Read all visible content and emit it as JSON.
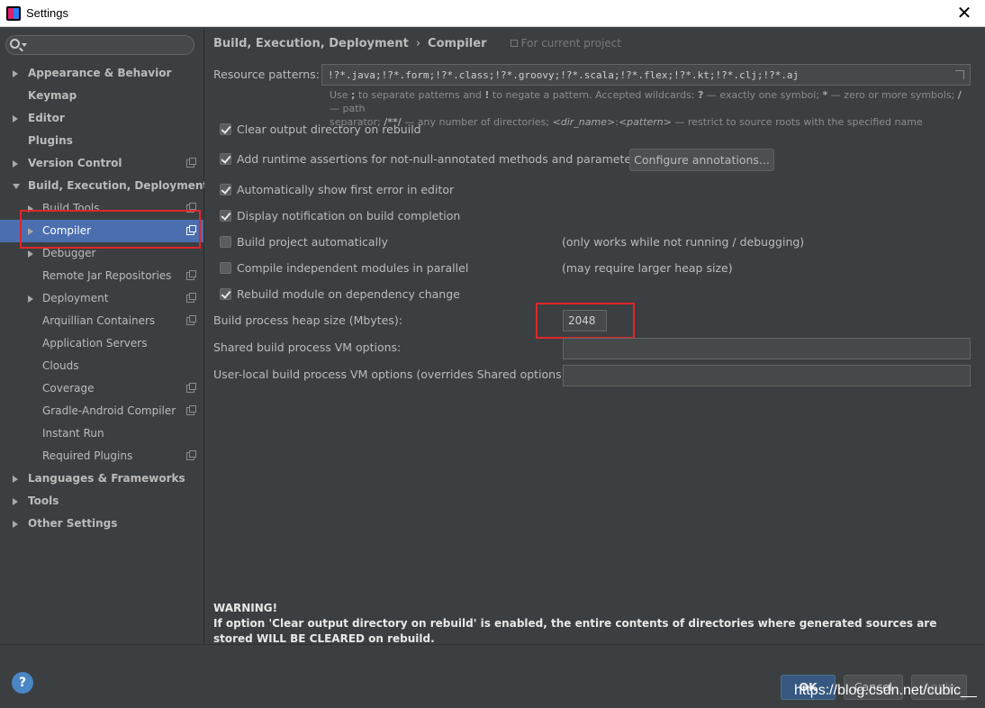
{
  "window": {
    "title": "Settings",
    "close_glyph": "✕"
  },
  "sidebar": {
    "search_placeholder": "",
    "items": [
      {
        "label": "Appearance & Behavior",
        "level": 0,
        "arrow": "right",
        "project": false
      },
      {
        "label": "Keymap",
        "level": 0,
        "arrow": "none",
        "project": false
      },
      {
        "label": "Editor",
        "level": 0,
        "arrow": "right",
        "project": false
      },
      {
        "label": "Plugins",
        "level": 0,
        "arrow": "none",
        "project": false
      },
      {
        "label": "Version Control",
        "level": 0,
        "arrow": "right",
        "project": true
      },
      {
        "label": "Build, Execution, Deployment",
        "level": 0,
        "arrow": "down",
        "project": false
      },
      {
        "label": "Build Tools",
        "level": 1,
        "arrow": "right",
        "project": true
      },
      {
        "label": "Compiler",
        "level": 1,
        "arrow": "right",
        "project": true,
        "selected": true
      },
      {
        "label": "Debugger",
        "level": 1,
        "arrow": "right",
        "project": false
      },
      {
        "label": "Remote Jar Repositories",
        "level": 1,
        "arrow": "none",
        "project": true
      },
      {
        "label": "Deployment",
        "level": 1,
        "arrow": "right",
        "project": true
      },
      {
        "label": "Arquillian Containers",
        "level": 1,
        "arrow": "none",
        "project": true
      },
      {
        "label": "Application Servers",
        "level": 1,
        "arrow": "none",
        "project": false
      },
      {
        "label": "Clouds",
        "level": 1,
        "arrow": "none",
        "project": false
      },
      {
        "label": "Coverage",
        "level": 1,
        "arrow": "none",
        "project": true
      },
      {
        "label": "Gradle-Android Compiler",
        "level": 1,
        "arrow": "none",
        "project": true
      },
      {
        "label": "Instant Run",
        "level": 1,
        "arrow": "none",
        "project": false
      },
      {
        "label": "Required Plugins",
        "level": 1,
        "arrow": "none",
        "project": true
      },
      {
        "label": "Languages & Frameworks",
        "level": 0,
        "arrow": "right",
        "project": false
      },
      {
        "label": "Tools",
        "level": 0,
        "arrow": "right",
        "project": false
      },
      {
        "label": "Other Settings",
        "level": 0,
        "arrow": "right",
        "project": false
      }
    ]
  },
  "breadcrumb": {
    "parent": "Build, Execution, Deployment",
    "separator": "›",
    "current": "Compiler",
    "scope": "For current project"
  },
  "resource_patterns": {
    "label": "Resource patterns:",
    "value": "!?*.java;!?*.form;!?*.class;!?*.groovy;!?*.scala;!?*.flex;!?*.kt;!?*.clj;!?*.aj",
    "hint_line1_a": "Use ",
    "hint_semicolon": ";",
    "hint_line1_b": " to separate patterns and ",
    "hint_bang": "!",
    "hint_line1_c": " to negate a pattern. Accepted wildcards: ",
    "hint_q": "?",
    "hint_line1_d": " — exactly one symbol; ",
    "hint_star": "*",
    "hint_line1_e": " — zero or more symbols; ",
    "hint_slash": "/",
    "hint_line1_f": " — path",
    "hint_line2_a": "separator; ",
    "hint_dstar": "/**/",
    "hint_line2_b": " — any number of directories; ",
    "hint_dirname": "<dir_name>",
    "hint_colon": ":",
    "hint_pattern": "<pattern>",
    "hint_line2_c": " — restrict to source roots with the specified name"
  },
  "options": [
    {
      "label": "Clear output directory on rebuild",
      "checked": true,
      "note": ""
    },
    {
      "label": "Add runtime assertions for not-null-annotated methods and parameters",
      "checked": true,
      "note": ""
    },
    {
      "label": "Automatically show first error in editor",
      "checked": true,
      "note": ""
    },
    {
      "label": "Display notification on build completion",
      "checked": true,
      "note": ""
    },
    {
      "label": "Build project automatically",
      "checked": false,
      "note": "(only works while not running / debugging)"
    },
    {
      "label": "Compile independent modules in parallel",
      "checked": false,
      "note": "(may require larger heap size)"
    },
    {
      "label": "Rebuild module on dependency change",
      "checked": true,
      "note": ""
    }
  ],
  "configure_button": "Configure annotations...",
  "heap": {
    "label": "Build process heap size (Mbytes):",
    "value": "2048"
  },
  "shared_vm": {
    "label": "Shared build process VM options:",
    "value": ""
  },
  "user_vm": {
    "label": "User-local build process VM options (overrides Shared options):",
    "value": ""
  },
  "warning": {
    "title": "WARNING!",
    "text": "If option 'Clear output directory on rebuild' is enabled, the entire contents of directories where generated sources are stored WILL BE CLEARED on rebuild."
  },
  "buttons": {
    "help": "?",
    "ok": "OK",
    "cancel": "Cancel",
    "apply": "Apply"
  },
  "watermark": "https://blog.csdn.net/cubic__",
  "colors": {
    "background": "#3c3f41",
    "selection": "#4b6eaf",
    "highlight_box": "#e0262a",
    "ok_button": "#365880"
  }
}
